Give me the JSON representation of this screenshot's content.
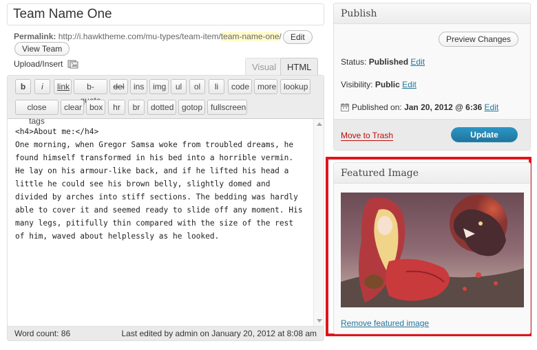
{
  "post": {
    "title": "Team Name One",
    "permalink_label": "Permalink:",
    "permalink_base": "http://i.hawktheme.com/mu-types/team-item/",
    "permalink_slug": "team-name-one",
    "permalink_trailing": "/",
    "edit_slug_label": "Edit",
    "view_label": "View Team"
  },
  "editor": {
    "upload_insert_label": "Upload/Insert",
    "tabs": {
      "visual": "Visual",
      "html": "HTML"
    },
    "toolbar_row1": [
      "b",
      "i",
      "link",
      "b-quote",
      "del",
      "ins",
      "img",
      "ul",
      "ol",
      "li",
      "code",
      "more",
      "lookup"
    ],
    "toolbar_row2": [
      "close tags",
      "clear",
      "box",
      "hr",
      "br",
      "dotted",
      "gotop",
      "fullscreen"
    ],
    "content": "<h4>About me:</h4>\nOne morning, when Gregor Samsa woke from troubled dreams, he found himself transformed in his bed into a horrible vermin. He lay on his armour-like back, and if he lifted his head a little he could see his brown belly, slightly domed and divided by arches into stiff sections. The bedding was hardly able to cover it and seemed ready to slide off any moment. His many legs, pitifully thin compared with the size of the rest of him, waved about helplessly as he looked.",
    "word_count": "Word count: 86",
    "last_edited": "Last edited by admin on January 20, 2012 at 8:08 am"
  },
  "publish": {
    "title": "Publish",
    "preview_label": "Preview Changes",
    "status_label": "Status:",
    "status_value": "Published",
    "visibility_label": "Visibility:",
    "visibility_value": "Public",
    "published_label": "Published on:",
    "published_value": "Jan 20, 2012 @ 6:36",
    "edit_label": "Edit",
    "trash_label": "Move to Trash",
    "update_label": "Update"
  },
  "featured": {
    "title": "Featured Image",
    "remove_label": "Remove featured image"
  },
  "colors": {
    "highlight": "#e0141b",
    "link": "#21759b",
    "trash": "#bc0b0b",
    "update_button": "#21759b"
  }
}
